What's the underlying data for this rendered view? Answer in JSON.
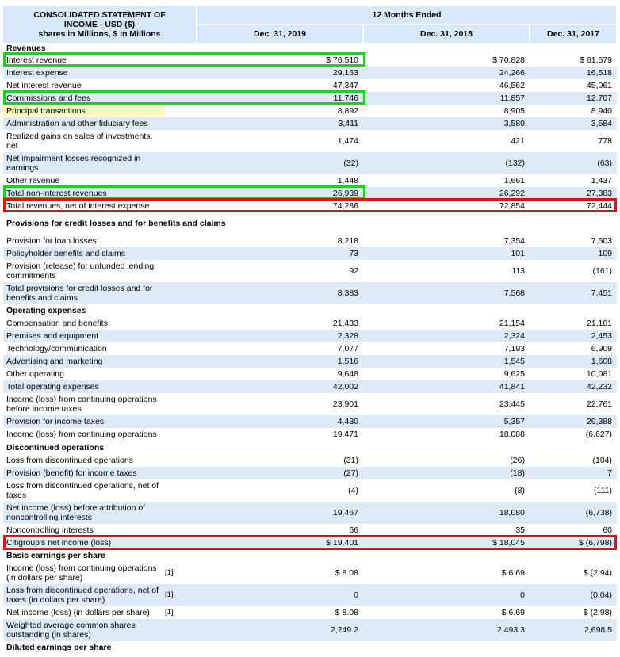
{
  "header": {
    "title_line1": "CONSOLIDATED STATEMENT OF",
    "title_line2": "INCOME - USD ($)",
    "title_line3": "shares in Millions, $ in Millions",
    "period_label": "12 Months Ended",
    "col1": "Dec. 31, 2019",
    "col2": "Dec. 31, 2018",
    "col3": "Dec. 31, 2017"
  },
  "rows": [
    {
      "label": "Revenues",
      "section": true
    },
    {
      "label": "Interest revenue",
      "v1": "$ 76,510",
      "v2": "$ 70,828",
      "v3": "$ 61,579"
    },
    {
      "label": "Interest expense",
      "v1": "29,163",
      "v2": "24,266",
      "v3": "16,518"
    },
    {
      "label": "Net interest revenue",
      "v1": "47,347",
      "v2": "46,562",
      "v3": "45,061"
    },
    {
      "label": "Commissions and fees",
      "v1": "11,746",
      "v2": "11,857",
      "v3": "12,707"
    },
    {
      "label": "Principal transactions",
      "v1": "8,892",
      "v2": "8,905",
      "v3": "8,940"
    },
    {
      "label": "Administration and other fiduciary fees",
      "v1": "3,411",
      "v2": "3,580",
      "v3": "3,584"
    },
    {
      "label": "Realized gains on sales of investments, net",
      "v1": "1,474",
      "v2": "421",
      "v3": "778"
    },
    {
      "label": "Net impairment losses recognized in earnings",
      "v1": "(32)",
      "v2": "(132)",
      "v3": "(63)"
    },
    {
      "label": "Other revenue",
      "v1": "1,448",
      "v2": "1,661",
      "v3": "1,437"
    },
    {
      "label": "Total non-interest revenues",
      "v1": "26,939",
      "v2": "26,292",
      "v3": "27,383"
    },
    {
      "label": "Total revenues, net of interest expense",
      "v1": "74,286",
      "v2": "72,854",
      "v3": "72,444"
    },
    {
      "label": "Provisions for credit losses and for benefits and claims",
      "section": true
    },
    {
      "label": "Provision for loan losses",
      "v1": "8,218",
      "v2": "7,354",
      "v3": "7,503"
    },
    {
      "label": "Policyholder benefits and claims",
      "v1": "73",
      "v2": "101",
      "v3": "109"
    },
    {
      "label": "Provision (release) for unfunded lending commitments",
      "v1": "92",
      "v2": "113",
      "v3": "(161)"
    },
    {
      "label": "Total provisions for credit losses and for benefits and claims",
      "v1": "8,383",
      "v2": "7,568",
      "v3": "7,451"
    },
    {
      "label": "Operating expenses",
      "section": true
    },
    {
      "label": "Compensation and benefits",
      "v1": "21,433",
      "v2": "21,154",
      "v3": "21,181"
    },
    {
      "label": "Premises and equipment",
      "v1": "2,328",
      "v2": "2,324",
      "v3": "2,453"
    },
    {
      "label": "Technology/communication",
      "v1": "7,077",
      "v2": "7,193",
      "v3": "6,909"
    },
    {
      "label": "Advertising and marketing",
      "v1": "1,516",
      "v2": "1,545",
      "v3": "1,608"
    },
    {
      "label": "Other operating",
      "v1": "9,648",
      "v2": "9,625",
      "v3": "10,081"
    },
    {
      "label": "Total operating expenses",
      "v1": "42,002",
      "v2": "41,841",
      "v3": "42,232"
    },
    {
      "label": "Income (loss) from continuing operations before income taxes",
      "v1": "23,901",
      "v2": "23,445",
      "v3": "22,761"
    },
    {
      "label": "Provision for income taxes",
      "v1": "4,430",
      "v2": "5,357",
      "v3": "29,388"
    },
    {
      "label": "Income (loss) from continuing operations",
      "v1": "19,471",
      "v2": "18,088",
      "v3": "(6,627)"
    },
    {
      "label": "Discontinued operations",
      "section": true
    },
    {
      "label": "Loss from discontinued operations",
      "v1": "(31)",
      "v2": "(26)",
      "v3": "(104)"
    },
    {
      "label": "Provision (benefit) for income taxes",
      "v1": "(27)",
      "v2": "(18)",
      "v3": "7"
    },
    {
      "label": "Loss from discontinued operations, net of taxes",
      "v1": "(4)",
      "v2": "(8)",
      "v3": "(111)"
    },
    {
      "label": "Net income (loss) before attribution of noncontrolling interests",
      "v1": "19,467",
      "v2": "18,080",
      "v3": "(6,738)"
    },
    {
      "label": "Noncontrolling interests",
      "v1": "66",
      "v2": "35",
      "v3": "60"
    },
    {
      "label": "Citigroup's net income (loss)",
      "v1": "$ 19,401",
      "v2": "$ 18,045",
      "v3": "$ (6,798)"
    },
    {
      "label": "Basic earnings per share",
      "section": true
    },
    {
      "label": "Income (loss) from continuing operations (in dollars per share)",
      "fn": "[1]",
      "v1": "$ 8.08",
      "v2": "$ 6.69",
      "v3": "$ (2.94)"
    },
    {
      "label": "Loss from discontinued operations, net of taxes (in dollars per share)",
      "fn": "[1]",
      "v1": "0",
      "v2": "0",
      "v3": "(0.04)"
    },
    {
      "label": "Net income (loss) (in dollars per share)",
      "fn": "[1]",
      "v1": "$ 8.08",
      "v2": "$ 6.69",
      "v3": "$ (2.98)"
    },
    {
      "label": "Weighted average common shares outstanding (in shares)",
      "v1": "2,249.2",
      "v2": "2,493.3",
      "v3": "2,698.5"
    },
    {
      "label": "Diluted earnings per share",
      "section": true
    }
  ],
  "colors": {
    "header_bg": "#d6e8fa",
    "row_shade": "#deebf7",
    "highlight_green": "#22cc22",
    "highlight_red": "#dd1111",
    "highlight_yellow": "#fff9c4"
  }
}
